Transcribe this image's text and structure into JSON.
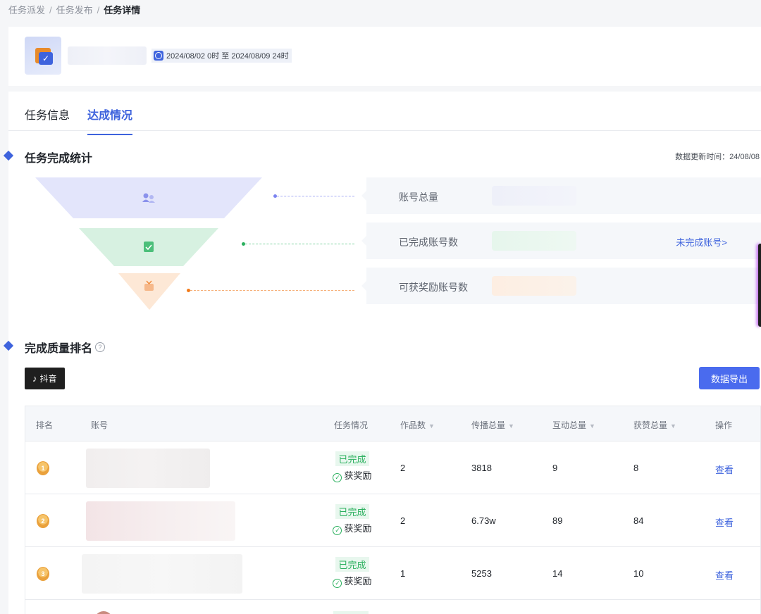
{
  "breadcrumb": [
    "任务派发",
    "任务发布",
    "任务详情"
  ],
  "breadcrumb_sep": "/",
  "task": {
    "period": "2024/08/02 0时 至 2024/08/09 24时"
  },
  "tabs": [
    {
      "label": "任务信息"
    },
    {
      "label": "达成情况",
      "active": true
    }
  ],
  "stats": {
    "title": "任务完成统计",
    "updated": "数据更新时间：24/08/08",
    "items": [
      {
        "label": "账号总量",
        "color": "#7b83f0"
      },
      {
        "label": "已完成账号数",
        "color": "#2bb05e",
        "link": "未完成账号>"
      },
      {
        "label": "可获奖励账号数",
        "color": "#f27b1a"
      }
    ]
  },
  "ranking": {
    "title": "完成质量排名",
    "help_icon": "question-circle-icon",
    "platform": "抖音",
    "platform_icon": "tiktok-icon",
    "export_label": "数据导出",
    "columns": [
      "排名",
      "账号",
      "任务情况",
      "作品数",
      "传播总量",
      "互动总量",
      "获赞总量",
      "操作"
    ],
    "sort_icon": "▼",
    "rows": [
      {
        "rank": "1",
        "status": "已完成",
        "reward": "获奖励",
        "works": "2",
        "spread": "3818",
        "interact": "9",
        "likes": "8",
        "action": "查看"
      },
      {
        "rank": "2",
        "status": "已完成",
        "reward": "获奖励",
        "works": "2",
        "spread": "6.73w",
        "interact": "89",
        "likes": "84",
        "action": "查看"
      },
      {
        "rank": "3",
        "status": "已完成",
        "reward": "获奖励",
        "works": "1",
        "spread": "5253",
        "interact": "14",
        "likes": "10",
        "action": "查看"
      }
    ]
  },
  "colors": {
    "accent": "#3e63dd",
    "success": "#2bb05e",
    "warning": "#f27b1a"
  }
}
